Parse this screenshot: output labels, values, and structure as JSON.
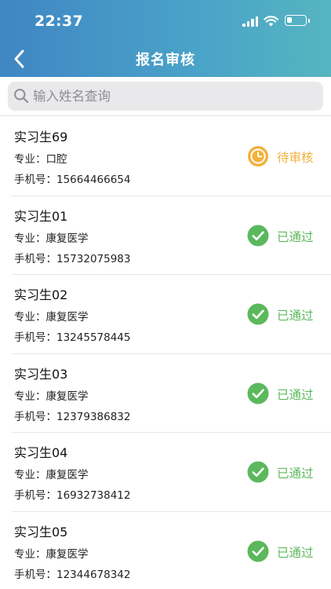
{
  "status_bar": {
    "time": "22:37"
  },
  "header": {
    "title": "报名审核"
  },
  "search": {
    "placeholder": "输入姓名查询"
  },
  "colors": {
    "pending": "#f2b13a",
    "approved": "#5cb85c"
  },
  "items": [
    {
      "name": "实习生69",
      "major_label": "专业：",
      "major": "口腔",
      "phone_label": "手机号：",
      "phone": "15664466654",
      "status": "待审核",
      "status_icon": "clock-icon",
      "status_type": "pending"
    },
    {
      "name": "实习生01",
      "major_label": "专业：",
      "major": "康复医学",
      "phone_label": "手机号：",
      "phone": "15732075983",
      "status": "已通过",
      "status_icon": "check-circle-icon",
      "status_type": "approved"
    },
    {
      "name": "实习生02",
      "major_label": "专业：",
      "major": "康复医学",
      "phone_label": "手机号：",
      "phone": "13245578445",
      "status": "已通过",
      "status_icon": "check-circle-icon",
      "status_type": "approved"
    },
    {
      "name": "实习生03",
      "major_label": "专业：",
      "major": "康复医学",
      "phone_label": "手机号：",
      "phone": "12379386832",
      "status": "已通过",
      "status_icon": "check-circle-icon",
      "status_type": "approved"
    },
    {
      "name": "实习生04",
      "major_label": "专业：",
      "major": "康复医学",
      "phone_label": "手机号：",
      "phone": "16932738412",
      "status": "已通过",
      "status_icon": "check-circle-icon",
      "status_type": "approved"
    },
    {
      "name": "实习生05",
      "major_label": "专业：",
      "major": "康复医学",
      "phone_label": "手机号：",
      "phone": "12344678342",
      "status": "已通过",
      "status_icon": "check-circle-icon",
      "status_type": "approved"
    }
  ]
}
